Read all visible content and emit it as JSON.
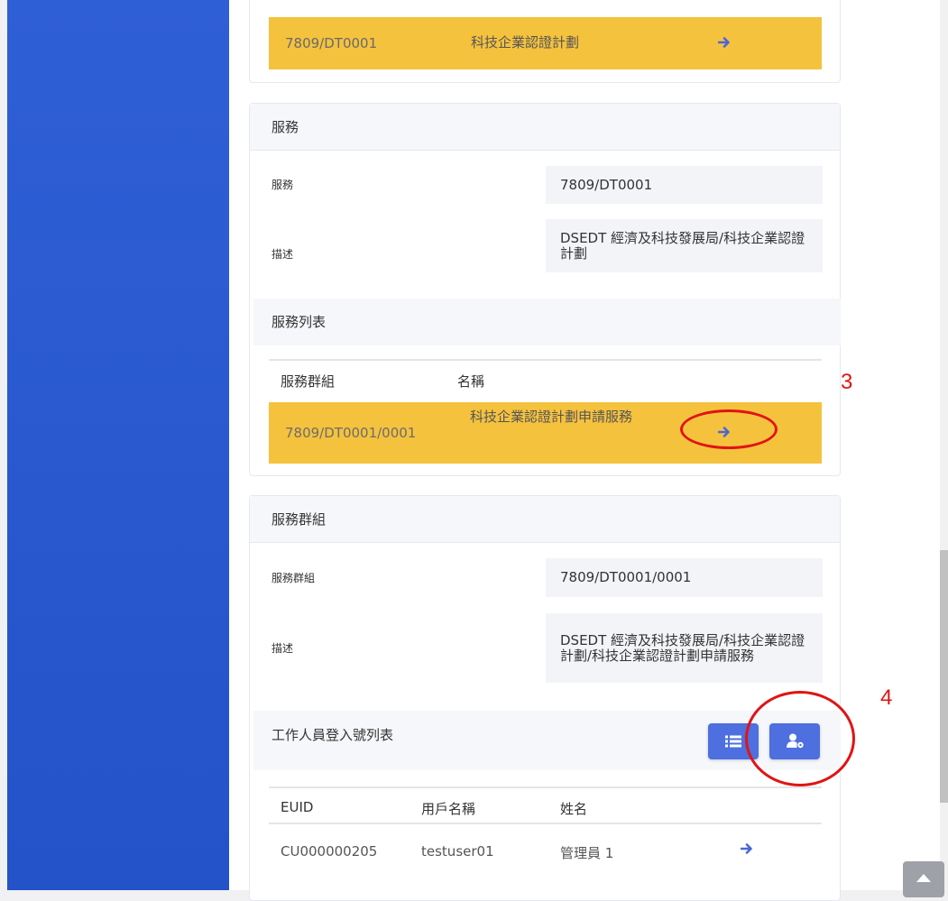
{
  "service_card": {
    "top_row": {
      "code": "7809/DT0001",
      "name": "科技企業認證計劃"
    }
  },
  "service_section": {
    "title": "服務",
    "fields": [
      {
        "label": "服務",
        "value": "7809/DT0001"
      },
      {
        "label": "描述",
        "value": "DSEDT 經濟及科技發展局/科技企業認證計劃"
      }
    ],
    "list_title": "服務列表",
    "table": {
      "headers": [
        "服務群組",
        "名稱"
      ],
      "rows": [
        {
          "code": "7809/DT0001/0001",
          "name": "科技企業認證計劃申請服務"
        }
      ]
    }
  },
  "service_group_section": {
    "title": "服務群組",
    "fields": [
      {
        "label": "服務群組",
        "value": "7809/DT0001/0001"
      },
      {
        "label": "描述",
        "value": "DSEDT 經濟及科技發展局/科技企業認證計劃/科技企業認證計劃申請服務"
      }
    ],
    "staff_title": "工作人員登入號列表",
    "buttons": {
      "list": "list-icon",
      "manage": "user-cog-icon"
    },
    "table": {
      "headers": [
        "EUID",
        "用戶名稱",
        "姓名"
      ],
      "rows": [
        {
          "euid": "CU000000205",
          "username": "testuser01",
          "name": "管理員 1"
        }
      ]
    }
  },
  "annotations": {
    "step3": "3",
    "step4": "4"
  },
  "colors": {
    "sidebar": "#2f5fd6",
    "highlight": "#f5c23e",
    "accent": "#4d6fdf",
    "annotation": "#e01414"
  }
}
